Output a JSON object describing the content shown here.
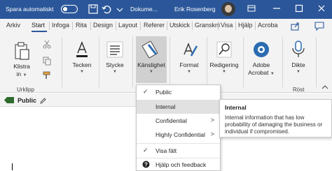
{
  "titlebar": {
    "autosave_label": "Spara automatiskt",
    "doc_title": "Dokume...",
    "user_name": "Erik Rosenberg",
    "color": "#2b579a"
  },
  "tabs": [
    "Arkiv",
    "Start",
    "Infoga",
    "Rita",
    "Design",
    "Layout",
    "Referer",
    "Utskick",
    "Granskni",
    "Visa",
    "Hjälp",
    "Acroba"
  ],
  "active_tab": "Start",
  "ribbon": {
    "paste_label": "Klistra",
    "paste_sub": "in",
    "clipboard_group": "Urklipp",
    "font_label": "Tecken",
    "styles_label": "Stycke",
    "sensitivity_label": "Känslighet",
    "format_label": "Format",
    "editing_label": "Redigering",
    "adobe_label": "Adobe",
    "adobe_sub": "Acrobat",
    "dictate_label": "Dikte",
    "voice_group": "Röst"
  },
  "label_bar": {
    "current_label": "Public"
  },
  "menu": {
    "items": [
      {
        "label": "Public",
        "checked": true
      },
      {
        "label": "Internal",
        "highlighted": true
      },
      {
        "label": "Confidential",
        "submenu": true
      },
      {
        "label": "Highly Confidential",
        "submenu": true
      },
      {
        "label": "Visa fält",
        "checked": true
      },
      {
        "label": "Hjälp och feedback"
      }
    ]
  },
  "tooltip": {
    "title": "Internal",
    "body": "Internal information that has low probability of damaging the business or individual if compromised."
  }
}
